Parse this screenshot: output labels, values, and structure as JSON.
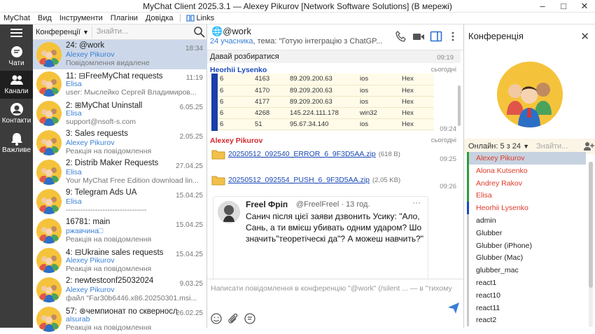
{
  "window": {
    "title": "MyChat Client 2025.3.1 — Alexey Pikurov [Network Software Solutions] (В мережі)"
  },
  "menu": {
    "items": [
      "MyChat",
      "Вид",
      "Інструменти",
      "Плагіни",
      "Довідка"
    ],
    "links": "Links"
  },
  "rail": {
    "items": [
      {
        "label": "Чати",
        "icon": "chat-icon"
      },
      {
        "label": "Канали",
        "icon": "users-icon"
      },
      {
        "label": "Контакти",
        "icon": "contact-icon"
      },
      {
        "label": "Важливе",
        "icon": "bell-icon"
      }
    ]
  },
  "chatlist": {
    "filter": "Конференції",
    "search_placeholder": "Знайти...",
    "items": [
      {
        "title": "24: @work",
        "user": "Alexey Pikurov",
        "msg": "Повідомлення видалене",
        "time": "18:34"
      },
      {
        "title": "11: ⊟FreeMyChat requests",
        "user": "Elisa",
        "msg": "user: Мыслейко Сергей Владимиров...",
        "time": "11:19"
      },
      {
        "title": "2: ⊞MyChat Uninstall",
        "user": "Elisa",
        "msg": "support@nsoft-s.com",
        "time": "6.05.25"
      },
      {
        "title": "3: Sales requests",
        "user": "Alexey Pikurov",
        "msg": "Реакція на повідомлення",
        "time": "2.05.25"
      },
      {
        "title": "2: Distrib Maker Requests",
        "user": "Elisa",
        "msg": "Your MyChat Free Edition download lin...",
        "time": "27.04.25"
      },
      {
        "title": "9: Telegram Ads UA",
        "user": "Elisa",
        "msg": "---------------------------------",
        "time": "15.04.25"
      },
      {
        "title": "16781: main",
        "user": "ржавчина□",
        "msg": "Реакція на повідомлення",
        "time": "15.04.25"
      },
      {
        "title": "4: ⊟Ukraine sales requests",
        "user": "Alexey Pikurov",
        "msg": "Реакція на повідомлення",
        "time": "15.04.25"
      },
      {
        "title": "2: newtestconf25032024",
        "user": "Alexey Pikurov",
        "msg": "файл \"Far30b6446.x86.20250301.msi...",
        "time": "9.03.25"
      },
      {
        "title": "57: ⊛чемпионат по скверносл...",
        "user": "alsurab",
        "msg": "Реакція на повідомлення",
        "time": "26.02.25"
      }
    ]
  },
  "chat": {
    "name": "@work",
    "count": "24 учасника",
    "topic": ", тема: \"Готую інтеграцію з ChatGP...",
    "messages": {
      "m1": {
        "text": "Давай розбиратися",
        "time": "09:19"
      },
      "m2": {
        "author": "Heorhii Lysenko",
        "time": "сьогодні",
        "time2": "09:24"
      },
      "table": [
        [
          "6",
          "4163",
          "89.209.200.63",
          "ios",
          "Нeх"
        ],
        [
          "6",
          "4170",
          "89.209.200.63",
          "ios",
          "Нeх"
        ],
        [
          "6",
          "4177",
          "89.209.200.63",
          "ios",
          "Нeх"
        ],
        [
          "6",
          "4268",
          "145.224.111.178",
          "win32",
          "Нeх"
        ],
        [
          "6",
          "51",
          "95.67.34.140",
          "ios",
          "Нeх"
        ]
      ],
      "m3": {
        "author": "Alexey Pikurov",
        "time": "сьогодні"
      },
      "file1": {
        "name": "20250512_092540_ERROR_6_9F3D5AA.zip",
        "size": "(618 B)",
        "time": "09:25"
      },
      "file2": {
        "name": "20250512_092554_PUSH_6_9F3D5AA.zip",
        "size": "(2,05 KB)",
        "time": "09:26"
      },
      "tweet": {
        "name": "Freel Фріп",
        "handle": "@FreelFreel · 13 год.",
        "text": "Санич після цієї заяви дзвонить Усику: \"Ало, Сань, а ти вмієш убивать одним ударом? Шо значить\"теоретіческі да\"? А можеш навчить?\""
      }
    },
    "compose_placeholder": "Написати повідомлення в конференцію \"@work\" (/silent ... — в \"тихому\""
  },
  "panel": {
    "title": "Конференція",
    "online": "Онлайн: 5 з 24",
    "search_placeholder": "Знайти...",
    "members": [
      {
        "name": "Alexey Pikurov",
        "color": "#e03a2a",
        "bar": "#2a9e3a"
      },
      {
        "name": "Alona Kutsenko",
        "color": "#e03a2a",
        "bar": "#2a9e3a"
      },
      {
        "name": "Andrey Rakov",
        "color": "#e03a2a",
        "bar": "#2a9e3a"
      },
      {
        "name": "Elisa",
        "color": "#e03a2a",
        "bar": "#2a9e3a"
      },
      {
        "name": "Heorhii Lysenko",
        "color": "#e03a2a",
        "bar": "#1f45c9"
      },
      {
        "name": "admin",
        "color": "#222",
        "bar": "#c8c8c8"
      },
      {
        "name": "Glubber",
        "color": "#222",
        "bar": "#c8c8c8"
      },
      {
        "name": "Glubber (iPhone)",
        "color": "#222",
        "bar": "#c8c8c8"
      },
      {
        "name": "Glubber (Mac)",
        "color": "#222",
        "bar": "#c8c8c8"
      },
      {
        "name": "glubber_mac",
        "color": "#222",
        "bar": "#c8c8c8"
      },
      {
        "name": "react1",
        "color": "#222",
        "bar": "#c8c8c8"
      },
      {
        "name": "react10",
        "color": "#222",
        "bar": "#c8c8c8"
      },
      {
        "name": "react11",
        "color": "#222",
        "bar": "#c8c8c8"
      },
      {
        "name": "react2",
        "color": "#222",
        "bar": "#c8c8c8"
      }
    ]
  },
  "colors": {
    "accent": "#3a7fd5",
    "rail": "#3c3c3c",
    "selected": "#ccd8e9",
    "author_blue": "#1a48b8",
    "author_red": "#d3262a"
  }
}
